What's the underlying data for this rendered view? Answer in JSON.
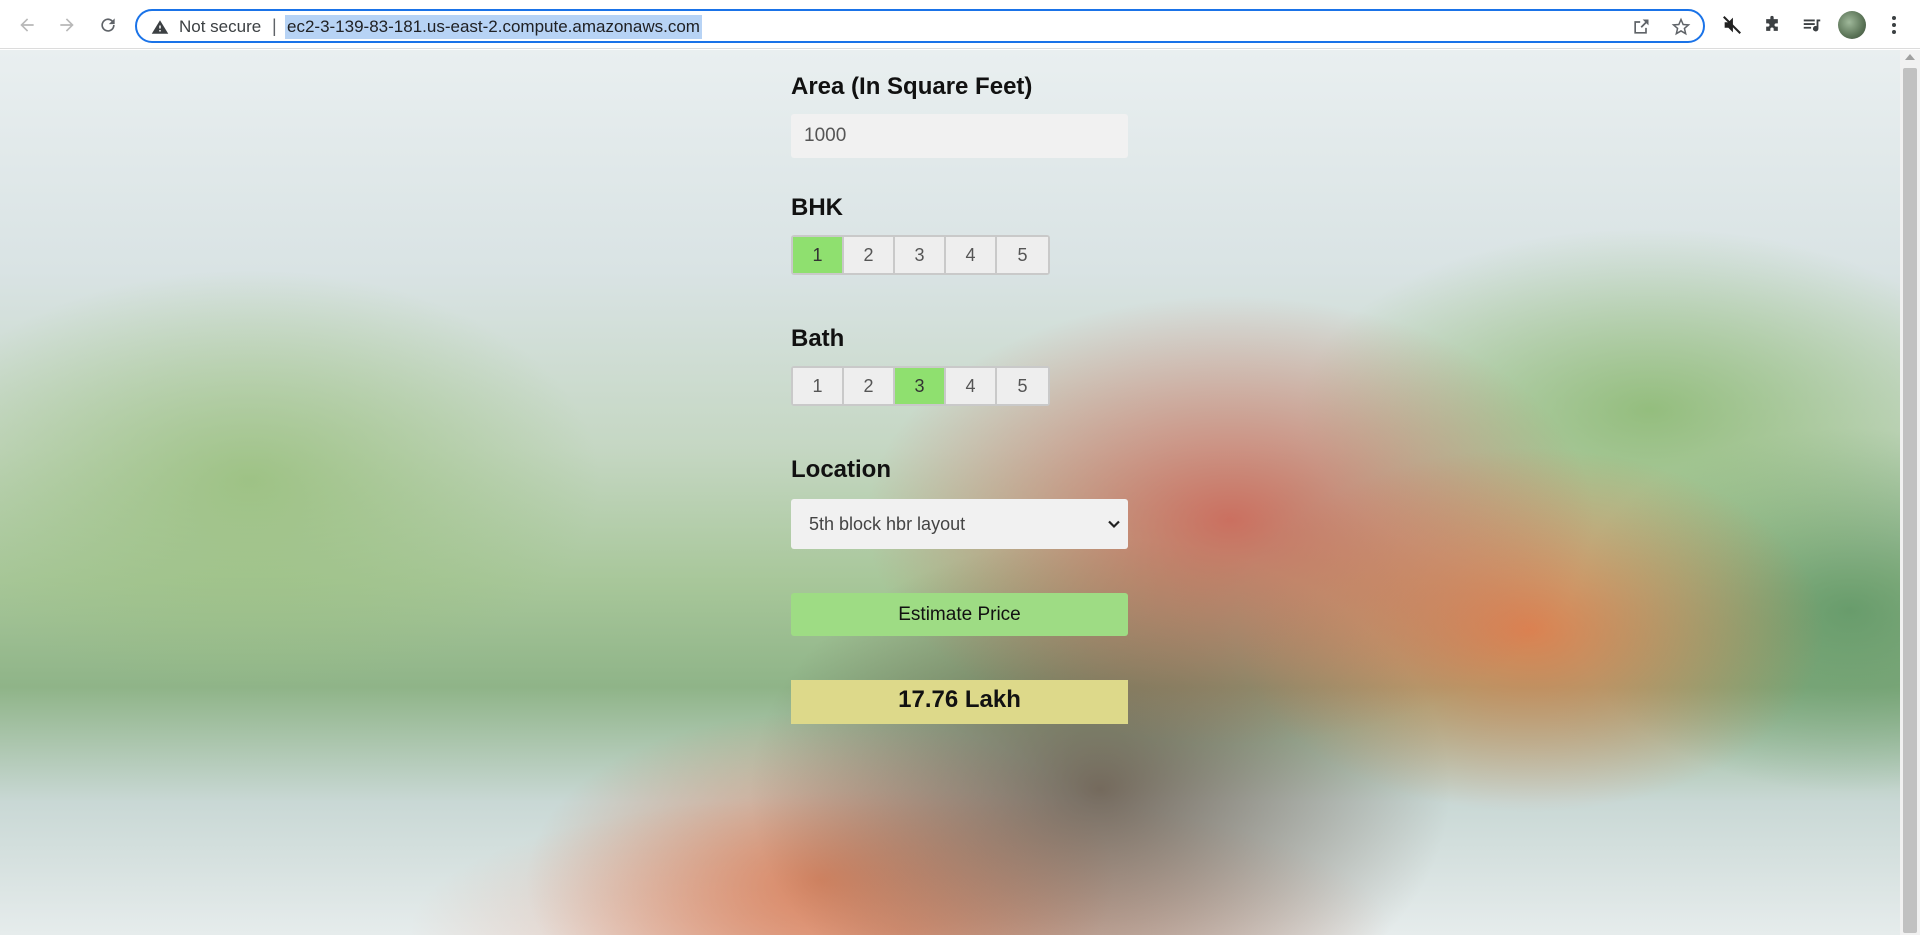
{
  "browser": {
    "security_label": "Not secure",
    "url": "ec2-3-139-83-181.us-east-2.compute.amazonaws.com"
  },
  "form": {
    "area": {
      "label": "Area (In Square Feet)",
      "value": "1000"
    },
    "bhk": {
      "label": "BHK",
      "options": [
        "1",
        "2",
        "3",
        "4",
        "5"
      ],
      "selected": "1"
    },
    "bath": {
      "label": "Bath",
      "options": [
        "1",
        "2",
        "3",
        "4",
        "5"
      ],
      "selected": "3"
    },
    "location": {
      "label": "Location",
      "selected": "5th block hbr layout"
    },
    "estimate_button": "Estimate Price",
    "result": "17.76 Lakh"
  },
  "colors": {
    "selected_option": "#8fe06f",
    "estimate_button": "#9edc84",
    "result_box": "#ddd98a",
    "omnibox_focus": "#1a73e8"
  }
}
